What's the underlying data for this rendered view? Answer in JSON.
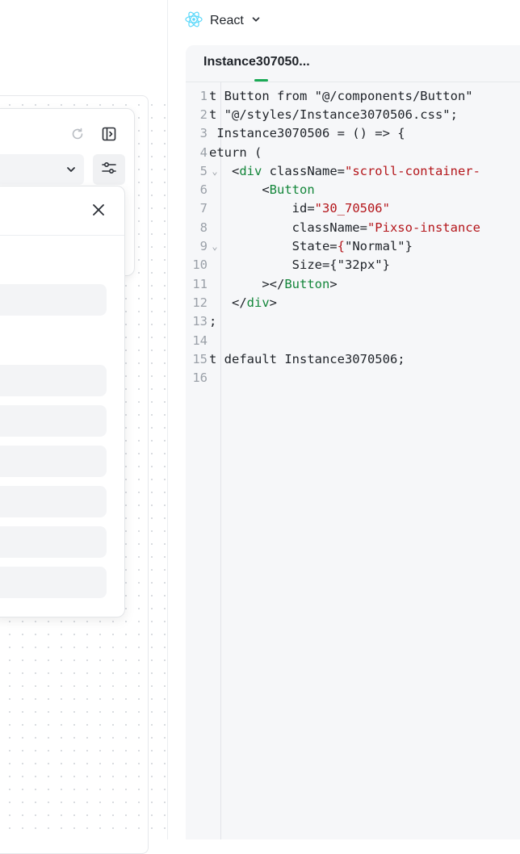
{
  "framework": {
    "label": "React",
    "icon": "react-logo-icon",
    "dropdown_icon": "chevron-down-icon",
    "accent": "#5ad8fa"
  },
  "code_panel": {
    "tab_label": "Instance307050...",
    "accent": "#1aaa55",
    "lines": [
      {
        "n": "1",
        "fold": false,
        "tokens": [
          {
            "t": "t Button from \"@/components/Button\"",
            "k": "code"
          }
        ]
      },
      {
        "n": "2",
        "fold": false,
        "tokens": [
          {
            "t": "t \"@/styles/Instance3070506.css\";",
            "k": "code"
          }
        ]
      },
      {
        "n": "3",
        "fold": false,
        "tokens": [
          {
            "t": " Instance3070506 = () => {",
            "k": "code"
          }
        ]
      },
      {
        "n": "4",
        "fold": false,
        "tokens": [
          {
            "t": "eturn (",
            "k": "code"
          }
        ]
      },
      {
        "n": "5",
        "fold": true,
        "tokens": [
          {
            "t": "   <",
            "k": "code"
          },
          {
            "t": "div",
            "k": "tag"
          },
          {
            "t": " className=",
            "k": "attr"
          },
          {
            "t": "\"scroll-container-",
            "k": "str"
          }
        ]
      },
      {
        "n": "6",
        "fold": false,
        "tokens": [
          {
            "t": "       <",
            "k": "code"
          },
          {
            "t": "Button",
            "k": "tag"
          }
        ]
      },
      {
        "n": "7",
        "fold": false,
        "tokens": [
          {
            "t": "           id=",
            "k": "attr"
          },
          {
            "t": "\"30_70506\"",
            "k": "str"
          }
        ]
      },
      {
        "n": "8",
        "fold": false,
        "tokens": [
          {
            "t": "           className=",
            "k": "attr"
          },
          {
            "t": "\"Pixso-instance",
            "k": "str"
          }
        ]
      },
      {
        "n": "9",
        "fold": true,
        "tokens": [
          {
            "t": "           State=",
            "k": "attr"
          },
          {
            "t": "{",
            "k": "str"
          },
          {
            "t": "\"Normal\"}",
            "k": "code"
          }
        ]
      },
      {
        "n": "10",
        "fold": false,
        "tokens": [
          {
            "t": "           Size={\"32px\"}",
            "k": "code"
          }
        ]
      },
      {
        "n": "11",
        "fold": false,
        "tokens": [
          {
            "t": "       ></",
            "k": "code"
          },
          {
            "t": "Button",
            "k": "tag"
          },
          {
            "t": ">",
            "k": "code"
          }
        ]
      },
      {
        "n": "12",
        "fold": false,
        "tokens": [
          {
            "t": "   </",
            "k": "code"
          },
          {
            "t": "div",
            "k": "tag"
          },
          {
            "t": ">",
            "k": "code"
          }
        ]
      },
      {
        "n": "13",
        "fold": false,
        "tokens": [
          {
            "t": ";",
            "k": "code"
          }
        ]
      },
      {
        "n": "14",
        "fold": false,
        "tokens": [
          {
            "t": "",
            "k": "code"
          }
        ]
      },
      {
        "n": "15",
        "fold": false,
        "tokens": [
          {
            "t": "t default Instance3070506;",
            "k": "code"
          }
        ]
      },
      {
        "n": "16",
        "fold": false,
        "tokens": [
          {
            "t": "",
            "k": "code"
          }
        ]
      }
    ]
  },
  "left_panel": {
    "icons": [
      "refresh-icon",
      "sidebar-toggle-icon",
      "chevron-down-icon",
      "sliders-icon",
      "close-icon"
    ]
  }
}
